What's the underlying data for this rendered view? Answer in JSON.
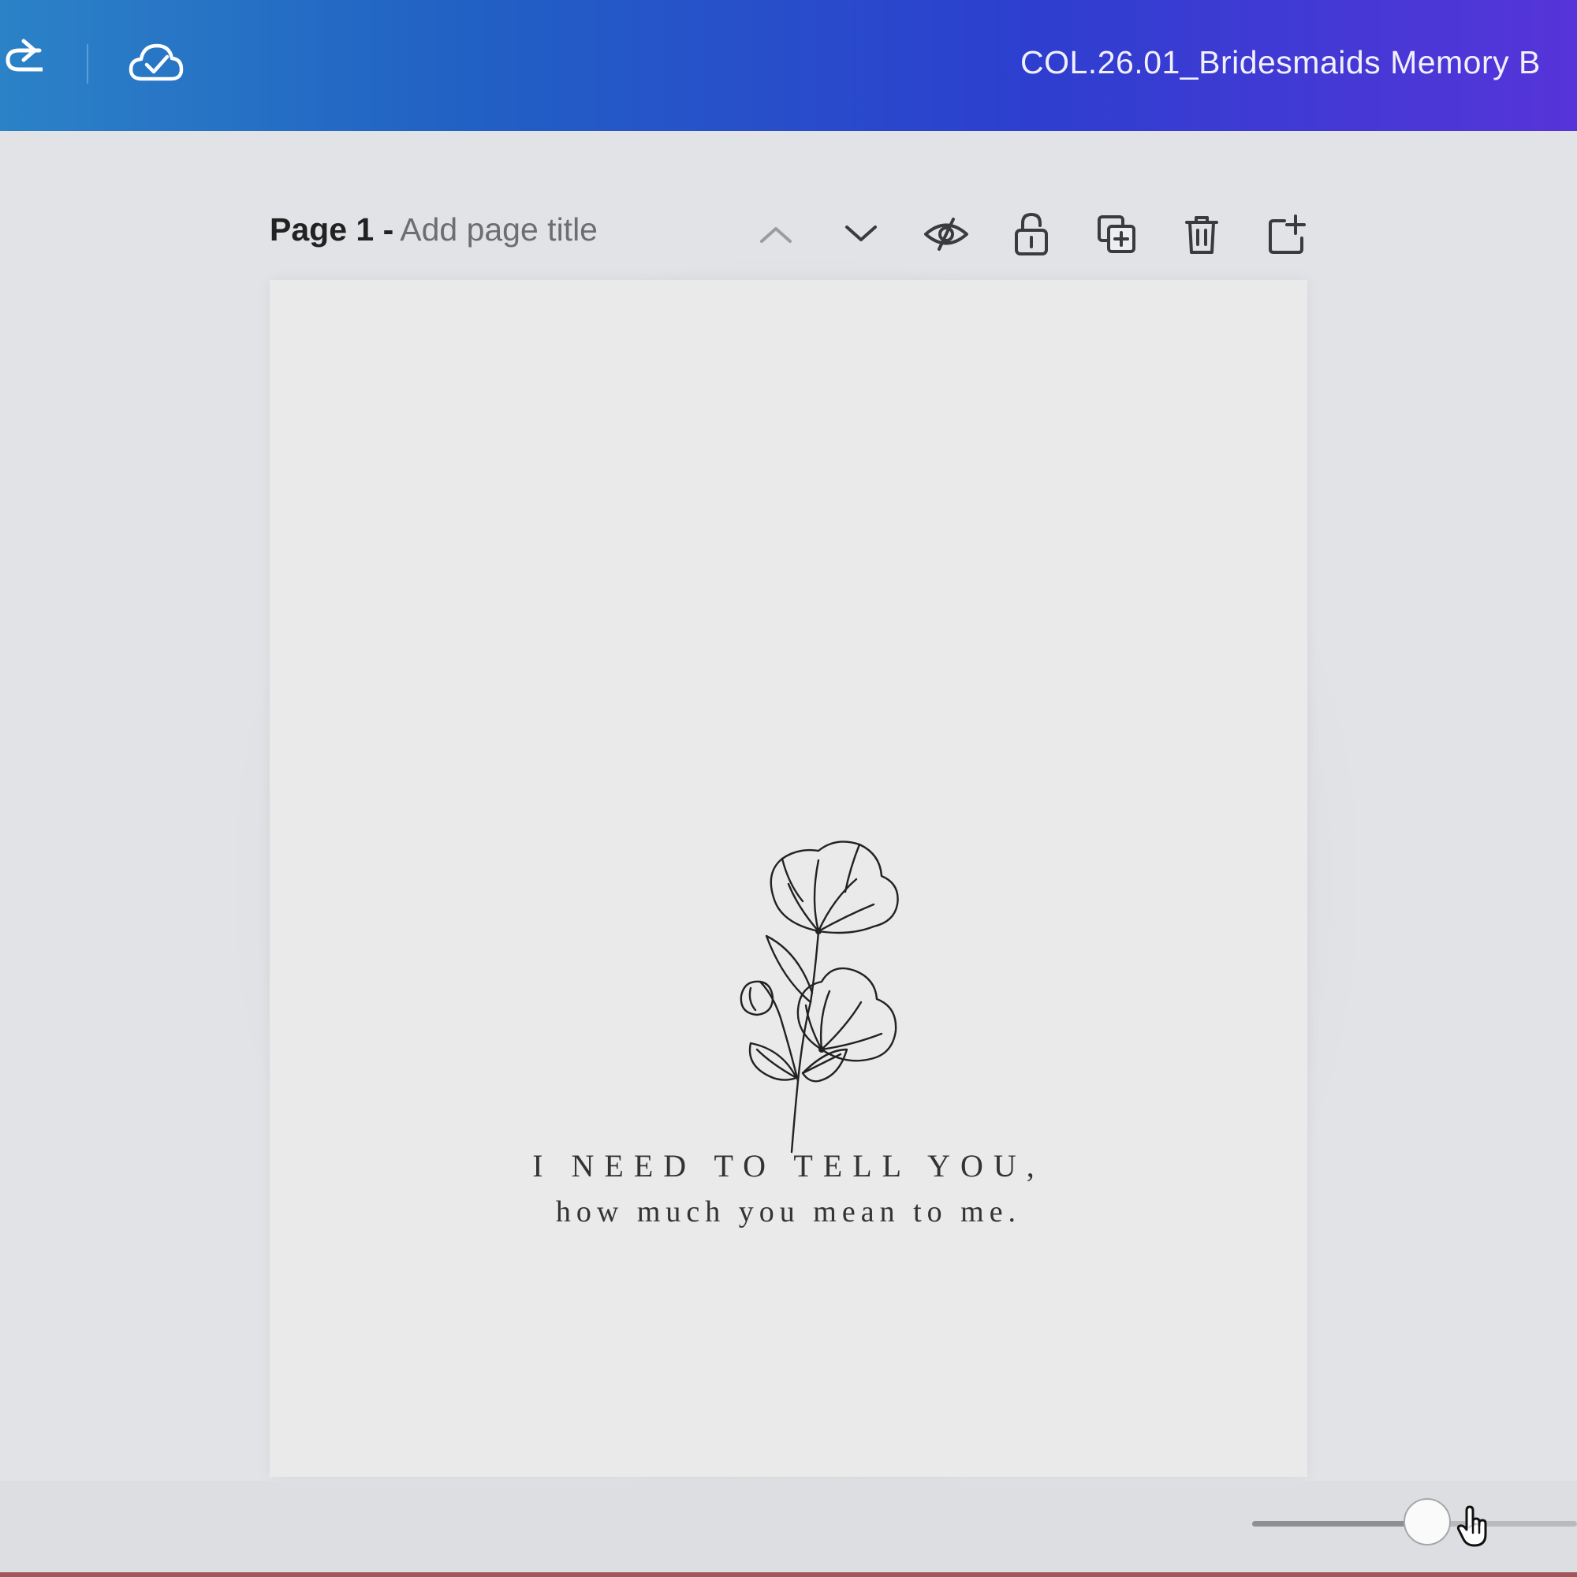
{
  "topbar": {
    "redo_icon": "redo-arrow-icon",
    "cloud_icon": "cloud-check-icon",
    "document_title": "COL.26.01_Bridesmaids Memory B"
  },
  "page_header": {
    "page_number": "Page 1 -",
    "page_title_placeholder": "Add page title",
    "tools": [
      "chevron-up-icon",
      "chevron-down-icon",
      "eye-hide-icon",
      "lock-open-icon",
      "duplicate-page-icon",
      "trash-icon",
      "add-page-icon"
    ]
  },
  "canvas": {
    "line1": "I NEED TO TELL YOU,",
    "line2": "how much you mean to me."
  },
  "zoom": {
    "value_fraction": 0.54
  },
  "colors": {
    "topbar_start": "#2b82c6",
    "topbar_end": "#5634d9",
    "canvas": "#eaeaea",
    "workspace": "#e1e3e6"
  }
}
